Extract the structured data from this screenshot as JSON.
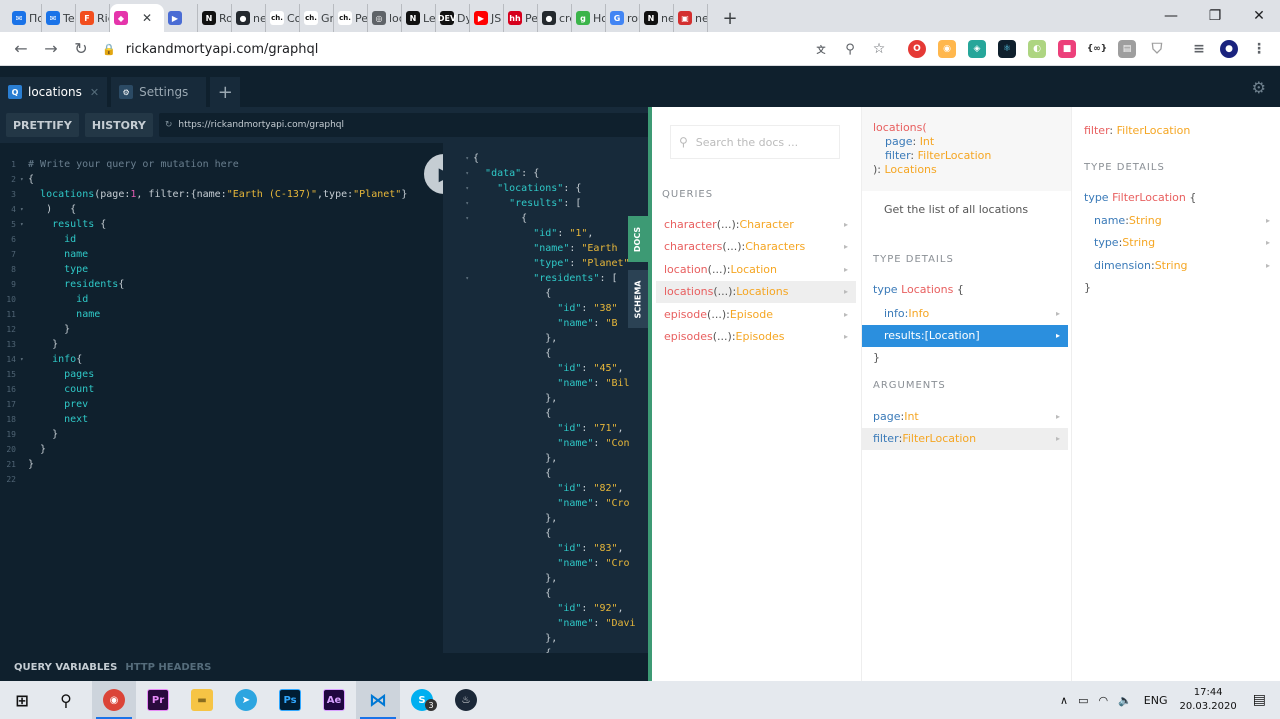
{
  "browser": {
    "tabs": [
      {
        "label": "По",
        "fav": "✉",
        "color": "#1a73e8"
      },
      {
        "label": "Tec",
        "fav": "✉",
        "color": "#1a73e8"
      },
      {
        "label": "Ric",
        "fav": "F",
        "color": "#f24e1e"
      },
      {
        "label": "",
        "fav": "◆",
        "color": "#e535ab",
        "active": true
      },
      {
        "label": "",
        "fav": "▶",
        "color": "#4a6cd4"
      },
      {
        "label": "Rou",
        "fav": "N",
        "color": "#111111"
      },
      {
        "label": "nex",
        "fav": "●",
        "color": "#24292e"
      },
      {
        "label": "Co",
        "fav": "ch.",
        "color": "#ffffff"
      },
      {
        "label": "Gra",
        "fav": "ch.",
        "color": "#ffffff"
      },
      {
        "label": "Per",
        "fav": "ch.",
        "color": "#ffffff"
      },
      {
        "label": "loc",
        "fav": "◎",
        "color": "#5f6368"
      },
      {
        "label": "Lea",
        "fav": "N",
        "color": "#111111"
      },
      {
        "label": "Dy",
        "fav": "DEV",
        "color": "#111111"
      },
      {
        "label": "JS f",
        "fav": "▶",
        "color": "#ff0000"
      },
      {
        "label": "Pe",
        "fav": "hh",
        "color": "#d6001c"
      },
      {
        "label": "cre",
        "fav": "●",
        "color": "#24292e"
      },
      {
        "label": "Ho",
        "fav": "g",
        "color": "#3bb44a"
      },
      {
        "label": "rou",
        "fav": "G",
        "color": "#4285f4"
      },
      {
        "label": "nex",
        "fav": "N",
        "color": "#111111"
      },
      {
        "label": "ne",
        "fav": "▣",
        "color": "#d32f2f"
      }
    ],
    "url": "rickandmortyapi.com/graphql"
  },
  "playground": {
    "tabs": [
      {
        "label": "locations"
      },
      {
        "label": "Settings"
      }
    ],
    "toolbar": {
      "prettify": "PRETTIFY",
      "history": "HISTORY",
      "endpoint": "https://rickandmortyapi.com/graphql"
    },
    "bottom": {
      "query_variables": "QUERY VARIABLES",
      "http_headers": "HTTP HEADERS"
    },
    "side_tabs": {
      "docs": "DOCS",
      "schema": "SCHEMA"
    }
  },
  "editor_lines": [
    "<span class='c'># Write your query or mutation here</span>",
    "<span class='p'>{</span>",
    "  <span class='k'>locations</span><span class='p'>(page:</span><span class='n'>1</span><span class='p'>, filter:{name:</span><span class='s'>\"Earth (C-137)\"</span><span class='p'>,type:</span><span class='s'>\"Planet\"</span><span class='p'>}</span>",
    "  <span class='p'> )   {</span>",
    "    <span class='k'>results</span> <span class='p'>{</span>",
    "      <span class='k'>id</span>",
    "      <span class='k'>name</span>",
    "      <span class='k'>type</span>",
    "      <span class='k'>residents</span><span class='p'>{</span>",
    "        <span class='k'>id</span>",
    "        <span class='k'>name</span>",
    "      <span class='p'>}</span>",
    "    <span class='p'>}</span>",
    "    <span class='k'>info</span><span class='p'>{</span>",
    "      <span class='k'>pages</span>",
    "      <span class='k'>count</span>",
    "      <span class='k'>prev</span>",
    "      <span class='k'>next</span>",
    "    <span class='p'>}</span>",
    "  <span class='p'>}</span>",
    "<span class='p'>}</span>",
    ""
  ],
  "result_lines": [
    "{",
    "  <span class='rk'>\"data\"</span>: {",
    "    <span class='rk'>\"locations\"</span>: {",
    "      <span class='rk'>\"results\"</span>: [",
    "        {",
    "          <span class='rk'>\"id\"</span>: <span class='rs'>\"1\"</span>,",
    "          <span class='rk'>\"name\"</span>: <span class='rs'>\"Earth</span>",
    "          <span class='rk'>\"type\"</span>: <span class='rs'>\"Planet\"</span>",
    "          <span class='rk'>\"residents\"</span>: [",
    "            {",
    "              <span class='rk'>\"id\"</span>: <span class='rs'>\"38\"</span>",
    "              <span class='rk'>\"name\"</span>: <span class='rs'>\"B</span>",
    "            },",
    "            {",
    "              <span class='rk'>\"id\"</span>: <span class='rs'>\"45\"</span>,",
    "              <span class='rk'>\"name\"</span>: <span class='rs'>\"Bil</span>",
    "            },",
    "            {",
    "              <span class='rk'>\"id\"</span>: <span class='rs'>\"71\"</span>,",
    "              <span class='rk'>\"name\"</span>: <span class='rs'>\"Con</span>",
    "            },",
    "            {",
    "              <span class='rk'>\"id\"</span>: <span class='rs'>\"82\"</span>,",
    "              <span class='rk'>\"name\"</span>: <span class='rs'>\"Cro</span>",
    "            },",
    "            {",
    "              <span class='rk'>\"id\"</span>: <span class='rs'>\"83\"</span>,",
    "              <span class='rk'>\"name\"</span>: <span class='rs'>\"Cro</span>",
    "            },",
    "            {",
    "              <span class='rk'>\"id\"</span>: <span class='rs'>\"92\"</span>,",
    "              <span class='rk'>\"name\"</span>: <span class='rs'>\"Davi</span>",
    "            },",
    "            {"
  ],
  "docs": {
    "search_placeholder": "Search the docs ...",
    "queries_title": "QUERIES",
    "queries": [
      {
        "name": "character",
        "args": "(...)",
        "sep": ": ",
        "type": "Character"
      },
      {
        "name": "characters",
        "args": "(...)",
        "sep": ": ",
        "type": "Characters"
      },
      {
        "name": "location",
        "args": "(...)",
        "sep": ": ",
        "type": "Location"
      },
      {
        "name": "locations",
        "args": "(...)",
        "sep": ": ",
        "type": "Locations",
        "selected": true
      },
      {
        "name": "episode",
        "args": "(...)",
        "sep": ": ",
        "type": "Episode"
      },
      {
        "name": "episodes",
        "args": "(...)",
        "sep": ": ",
        "type": "Episodes"
      }
    ],
    "col2": {
      "signature_name": "locations(",
      "sig_page": "page",
      "sig_page_type": "Int",
      "sig_filter": "filter",
      "sig_filter_type": "FilterLocation",
      "sig_close": "): ",
      "sig_return": "Locations",
      "description": "Get the list of all locations",
      "type_details_title": "TYPE DETAILS",
      "type_keyword": "type",
      "type_name": "Locations",
      "fields": [
        {
          "name": "info",
          "type": "Info"
        },
        {
          "name": "results",
          "type": "[Location]"
        }
      ],
      "arguments_title": "ARGUMENTS",
      "arguments": [
        {
          "name": "page",
          "type": "Int"
        },
        {
          "name": "filter",
          "type": "FilterLocation"
        }
      ]
    },
    "col3": {
      "header_name": "filter",
      "header_type": "FilterLocation",
      "type_details_title": "TYPE DETAILS",
      "type_keyword": "type",
      "type_name": "FilterLocation",
      "fields": [
        {
          "name": "name",
          "type": "String"
        },
        {
          "name": "type",
          "type": "String"
        },
        {
          "name": "dimension",
          "type": "String"
        }
      ]
    }
  },
  "taskbar": {
    "lang": "ENG",
    "time": "17:44",
    "date": "20.03.2020",
    "skype_badge": "3"
  }
}
